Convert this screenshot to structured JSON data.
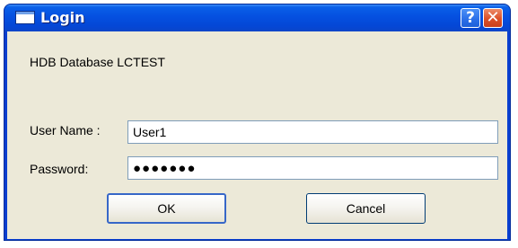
{
  "window": {
    "title": "Login"
  },
  "titlebar": {
    "help_label": "?",
    "close_label": "✕"
  },
  "dialog": {
    "database_label": "HDB Database LCTEST",
    "username_label": "User Name :",
    "username_value": "User1",
    "password_label": "Password:",
    "password_value": "●●●●●●●",
    "ok_label": "OK",
    "cancel_label": "Cancel"
  },
  "colors": {
    "titlebar": "#0550e0",
    "client_background": "#ece9d8",
    "close_button": "#dc5028",
    "input_border": "#7f9db9"
  }
}
